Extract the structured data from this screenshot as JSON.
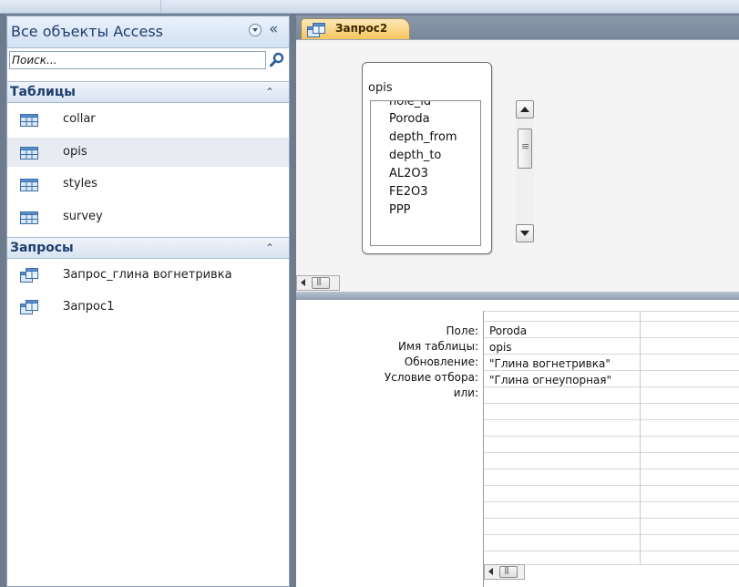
{
  "navigation": {
    "title": "Все объекты Access",
    "search_placeholder": "Поиск...",
    "groups": [
      {
        "label": "Таблицы",
        "items": [
          "collar",
          "opis",
          "styles",
          "survey"
        ]
      },
      {
        "label": "Запросы",
        "items": [
          "Запрос_глина вогнетривка",
          "Запрос1"
        ]
      }
    ],
    "selected_item": "opis"
  },
  "document": {
    "tab_label": "Запрос2",
    "table_box": {
      "title": "opis",
      "fields": [
        "hole_id",
        "Poroda",
        "depth_from",
        "depth_to",
        "AL2O3",
        "FE2O3",
        "PPP"
      ]
    },
    "grid": {
      "row_labels": [
        "Поле:",
        "Имя таблицы:",
        "Обновление:",
        "Условие отбора:",
        "или:"
      ],
      "column1": [
        "Poroda",
        "opis",
        "\"Глина вогнетривка\"",
        "\"Глина огнеупорная\"",
        ""
      ]
    }
  },
  "colors": {
    "nav_title": "#1e3e6d",
    "tab_active": "#f6c45a",
    "workspace_bg": "#6d7b8d"
  }
}
